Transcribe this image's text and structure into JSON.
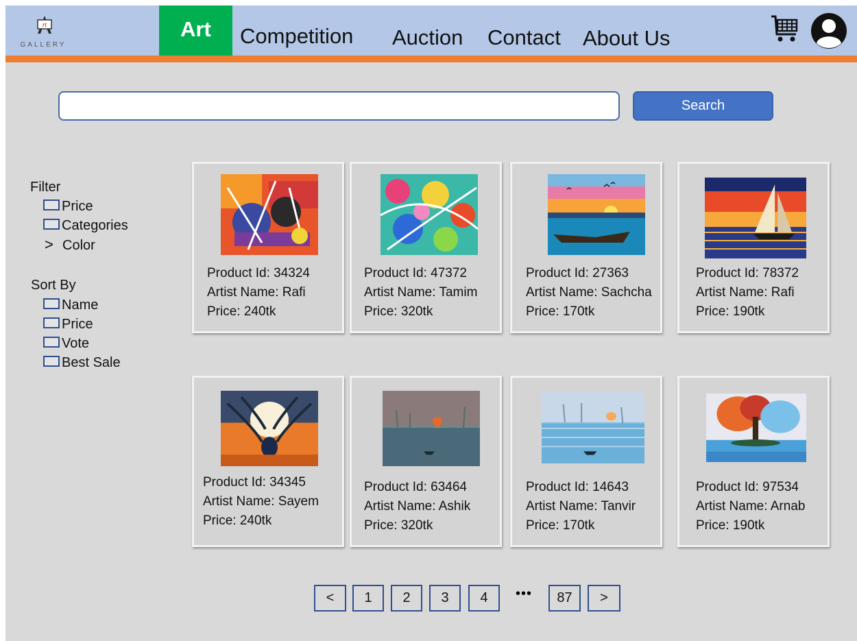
{
  "logo": {
    "text": "GALLERY",
    "mark": "rt"
  },
  "nav": {
    "active": "Art",
    "items": [
      "Competition",
      "Auction",
      "Contact",
      "About Us"
    ]
  },
  "icons": {
    "cart": "cart-icon",
    "profile": "profile-icon"
  },
  "search": {
    "placeholder": "",
    "value": "",
    "button_label": "Search"
  },
  "filter": {
    "heading": "Filter",
    "options": [
      {
        "label": "Price",
        "control": "checkbox"
      },
      {
        "label": "Categories",
        "control": "checkbox"
      },
      {
        "label": "Color",
        "control": "chevron",
        "chevron": ">"
      }
    ]
  },
  "sort": {
    "heading": "Sort By",
    "options": [
      {
        "label": "Name"
      },
      {
        "label": "Price"
      },
      {
        "label": "Vote"
      },
      {
        "label": "Best Sale"
      }
    ]
  },
  "products": [
    {
      "id_line": "Product Id: 34324",
      "artist_line": "Artist Name: Rafi",
      "price_line": "Price: 240tk"
    },
    {
      "id_line": "Product Id: 47372",
      "artist_line": "Artist Name: Tamim",
      "price_line": "Price: 320tk"
    },
    {
      "id_line": "Product Id: 27363",
      "artist_line": "Artist Name: Sachcha",
      "price_line": "Price: 170tk"
    },
    {
      "id_line": "Product Id: 78372",
      "artist_line": "Artist Name: Rafi",
      "price_line": "Price: 190tk"
    },
    {
      "id_line": "Product Id: 34345",
      "artist_line": "Artist Name: Sayem",
      "price_line": "Price: 240tk"
    },
    {
      "id_line": "Product Id: 63464",
      "artist_line": "Artist Name: Ashik",
      "price_line": "Price: 320tk"
    },
    {
      "id_line": "Product Id: 14643",
      "artist_line": "Artist Name: Tanvir",
      "price_line": "Price: 170tk"
    },
    {
      "id_line": "Product Id: 97534",
      "artist_line": "Artist Name: Arnab",
      "price_line": "Price: 190tk"
    }
  ],
  "pagination": {
    "prev": "<",
    "pages": [
      "1",
      "2",
      "3",
      "4"
    ],
    "ellipsis": "•••",
    "last": "87",
    "next": ">"
  },
  "colors": {
    "header_bg": "#b4c7e7",
    "accent_bar": "#ed7d31",
    "active_nav": "#00b050",
    "search_button": "#4472c4",
    "page_bg": "#d9d9d9"
  }
}
